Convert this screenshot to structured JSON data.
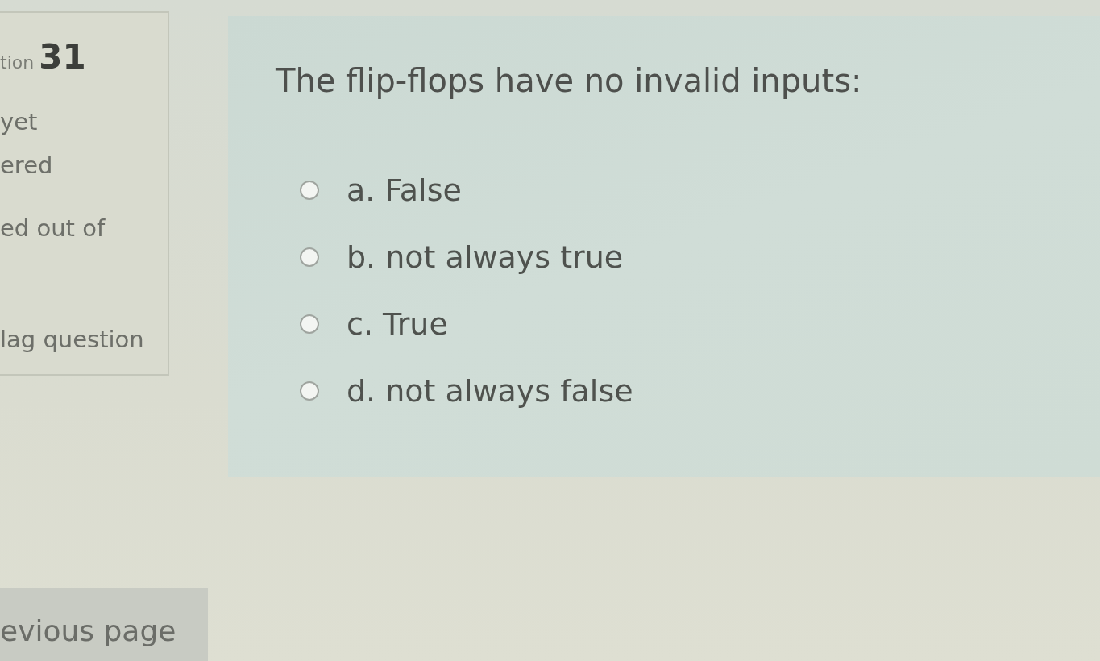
{
  "sidebar": {
    "question_label": "tion",
    "question_number": "31",
    "status_lines": [
      "yet",
      "ered"
    ],
    "mark": "ed out of",
    "flag": "lag question"
  },
  "question": {
    "text": "The flip-flops have no invalid inputs:",
    "options": [
      {
        "label": "a. False",
        "selected": false
      },
      {
        "label": "b. not always true",
        "selected": false
      },
      {
        "label": "c. True",
        "selected": false
      },
      {
        "label": "d. not always false",
        "selected": false
      }
    ]
  },
  "navigation": {
    "previous": "evious page"
  }
}
